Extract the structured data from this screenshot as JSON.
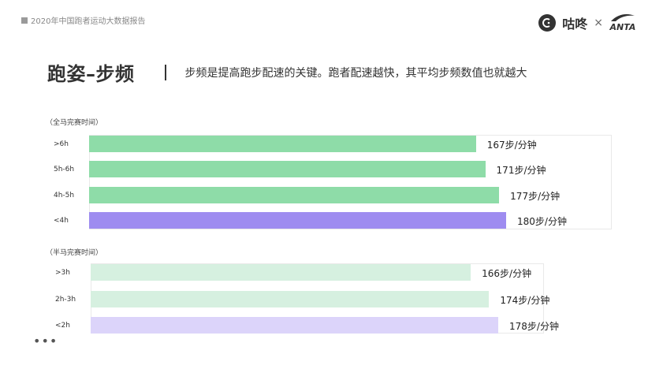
{
  "report": {
    "tag": "2020年中国跑者运动大数据报告"
  },
  "brand": {
    "logo_text": "咕咚",
    "times": "×",
    "partner": "ANTA"
  },
  "header": {
    "title": "跑姿–步频",
    "subtitle": "步频是提高跑步配速的关键。跑者配速越快，其平均步频数值也就越大"
  },
  "more": {
    "label": "•••"
  },
  "chart_data": [
    {
      "type": "bar",
      "orientation": "horizontal",
      "group_label": "（全马完赛时间）",
      "categories": [
        ">6h",
        "5h-6h",
        "4h-5h",
        "<4h"
      ],
      "values": [
        167,
        171,
        177,
        180
      ],
      "value_labels": [
        "167步/分钟",
        "171步/分钟",
        "177步/分钟",
        "180步/分钟"
      ],
      "unit": "步/分钟",
      "colors": [
        "#8edca8",
        "#8edca8",
        "#8edca8",
        "#9e8cf0"
      ]
    },
    {
      "type": "bar",
      "orientation": "horizontal",
      "group_label": "（半马完赛时间）",
      "categories": [
        ">3h",
        "2h-3h",
        "<2h"
      ],
      "values": [
        166,
        174,
        178
      ],
      "value_labels": [
        "166步/分钟",
        "174步/分钟",
        "178步/分钟"
      ],
      "unit": "步/分钟",
      "colors": [
        "#d6f0e0",
        "#d6f0e0",
        "#dcd4fa"
      ]
    }
  ]
}
